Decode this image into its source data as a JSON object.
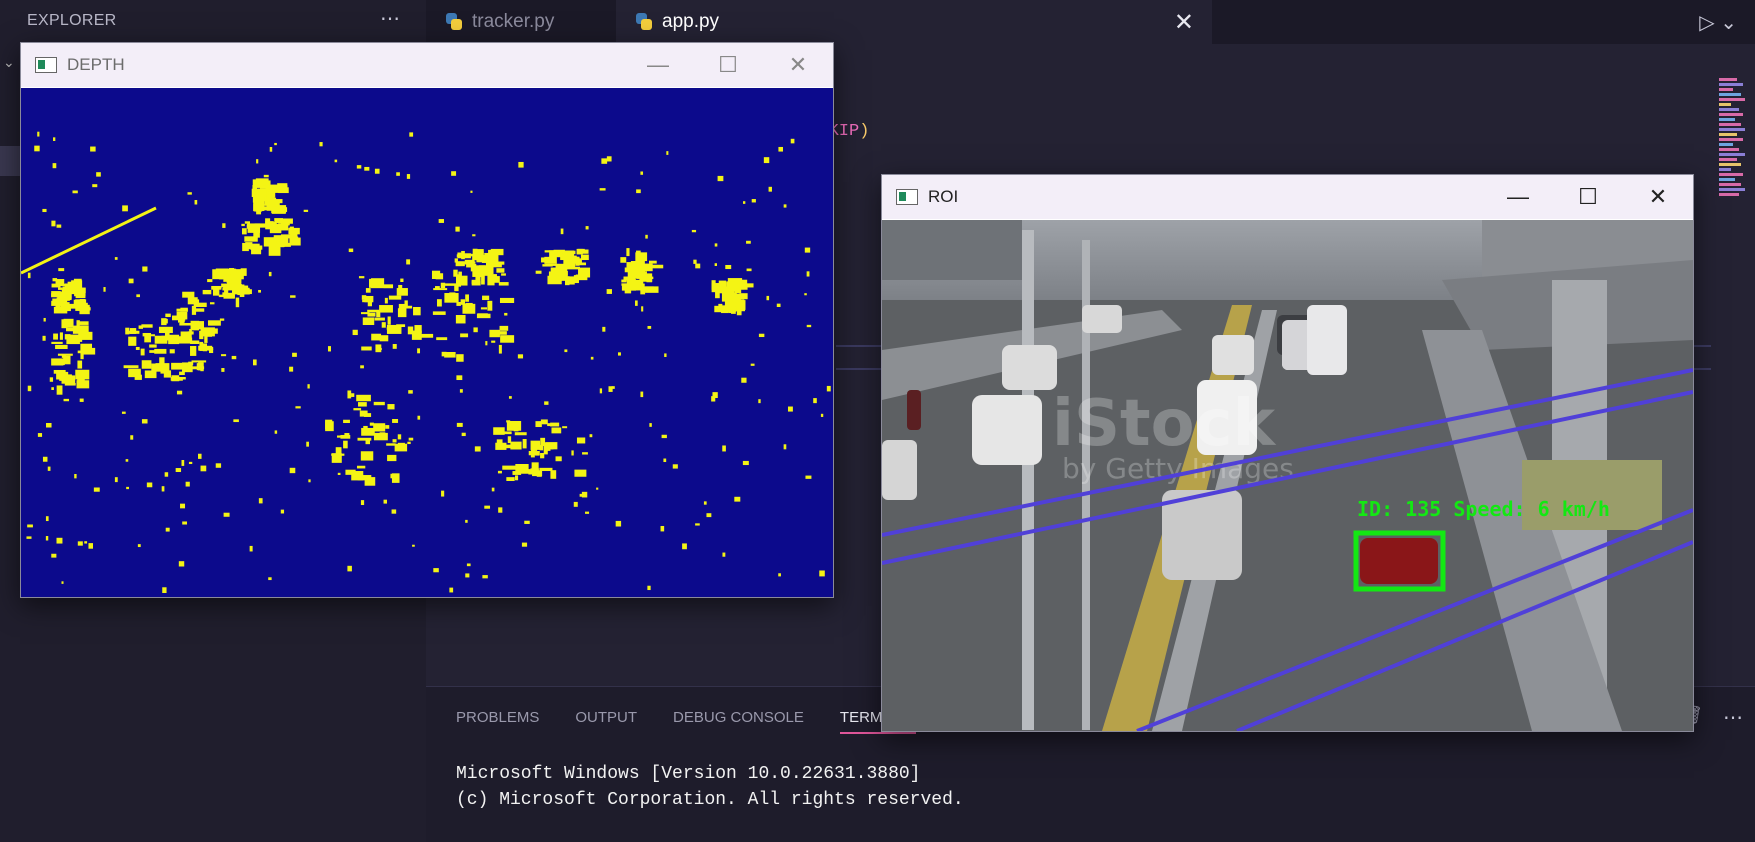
{
  "sidebar": {
    "title": "EXPLORER",
    "more_icon": "ellipsis-icon"
  },
  "tabs": [
    {
      "label": "tracker.py",
      "icon": "python-icon",
      "active": false
    },
    {
      "label": "app.py",
      "icon": "python-icon",
      "active": true
    }
  ],
  "editor": {
    "code_fragment": "E_SKIP",
    "code_paren": ")"
  },
  "panel": {
    "tabs": [
      "PROBLEMS",
      "OUTPUT",
      "DEBUG CONSOLE",
      "TERMINAL"
    ],
    "active_tab": "TERMINAL",
    "terminal_lines": [
      "Microsoft Windows [Version 10.0.22631.3880]",
      "(c) Microsoft Corporation. All rights reserved."
    ]
  },
  "windows": {
    "depth": {
      "title": "DEPTH",
      "bg_color": "#0c0a8c",
      "fg_color": "#f4f414"
    },
    "roi": {
      "title": "ROI",
      "overlay_label": "ID: 135 Speed: 6 km/h",
      "watermark": "iStock",
      "watermark_sub": "by Getty Images",
      "box_color": "#13e813",
      "line_color": "#5040d8"
    }
  },
  "colors": {
    "accent": "#e0569a",
    "editor_bg": "#242233",
    "sidebar_bg": "#201e2d"
  }
}
